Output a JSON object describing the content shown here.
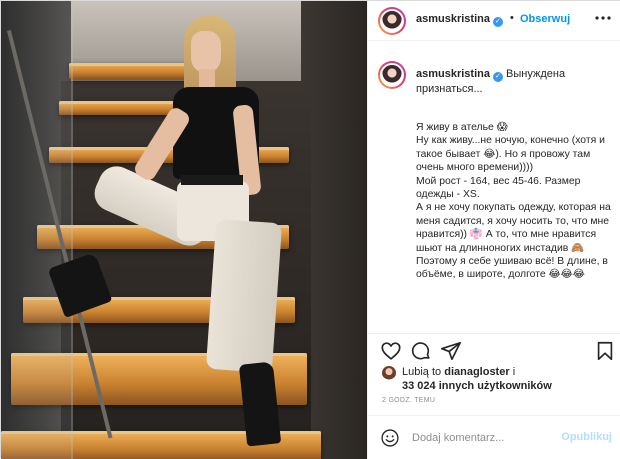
{
  "header": {
    "username": "asmuskristina",
    "separator": "•",
    "follow_label": "Obserwuj",
    "more_icon": "more-dots-icon"
  },
  "caption": {
    "username": "asmuskristina",
    "intro": "Вынуждена признаться...",
    "lines": [
      "Я живу в ателье 😱",
      "Ну как живу...не ночую, конечно (хотя и такое бывает 😂). Но я провожу там очень много времени))))",
      "Мой рост - 164, вес 45-46. Размер одежды - XS.",
      "А я не хочу покупать одежду, которая на меня садится, я хочу носить то, что мне нравится)) 👘 А то, что мне нравится шьют на длинноногих инстадив 🙈",
      "Поэтому я себе ушиваю всё! В длине, в объёме, в широте, долготе 😂😂😂"
    ]
  },
  "likes": {
    "prefix": "Lubią to",
    "user": "dianagloster",
    "and": "i",
    "count_text": "33 024 innych użytkowników"
  },
  "timestamp": "2 GODZ. TEMU",
  "comment": {
    "placeholder": "Dodaj komentarz...",
    "publish_label": "Opublikuj"
  },
  "colors": {
    "accent": "#0095f6",
    "verified": "#3897f0",
    "publish_disabled": "#b2dffc"
  }
}
